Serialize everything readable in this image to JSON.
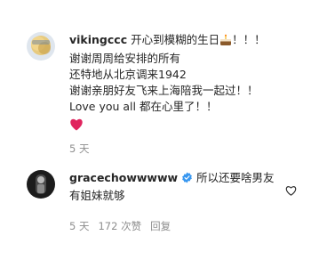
{
  "comments": [
    {
      "username": "vikingccc",
      "lines": [
        "开心到模糊的生日",
        "！！！",
        "谢谢周周给安排的所有",
        "还特地从北京调来1942",
        "谢谢亲朋好友飞来上海陪我一起过！！",
        "Love you all 都在心里了！！"
      ],
      "emoji": "cake-emoji",
      "reaction": "heart-emoji",
      "time": "5 天"
    },
    {
      "username": "gracechowwwww",
      "verified": true,
      "text": "所以还要啥男友 有姐妹就够",
      "time": "5 天",
      "likes": "172 次赞",
      "reply": "回复"
    }
  ],
  "colors": {
    "text": "#262626",
    "meta": "#8e8e8e",
    "verified": "#3897f0",
    "heart": "#ed4956"
  }
}
